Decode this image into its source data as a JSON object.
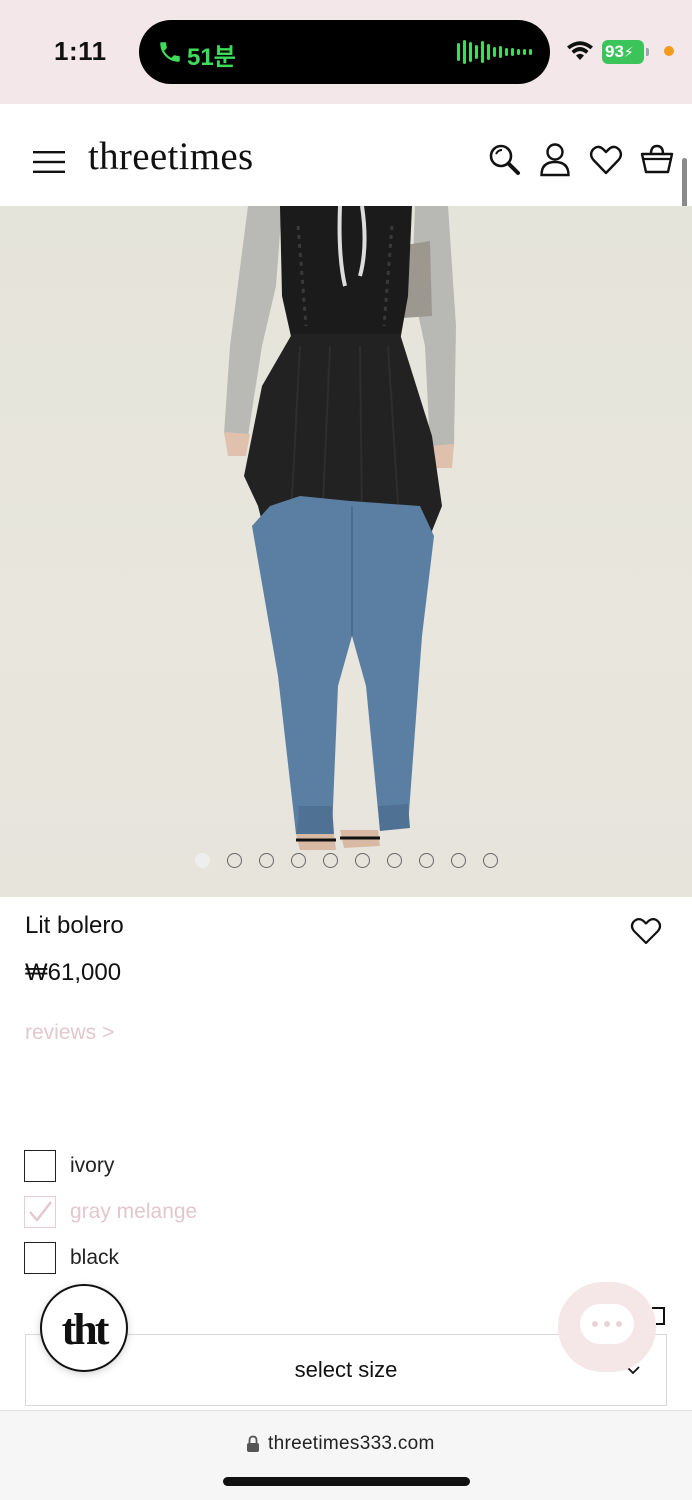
{
  "status_bar": {
    "time": "1:11",
    "call_duration": "51분",
    "battery": "93",
    "colors": {
      "call_green": "#3ddc5a",
      "battery_green": "#3bc45a",
      "mic_dot": "#f29a1a"
    }
  },
  "header": {
    "brand": "threetimes",
    "icons": [
      "menu-icon",
      "search-icon",
      "account-icon",
      "wishlist-icon",
      "cart-icon"
    ]
  },
  "gallery": {
    "image_count": 10,
    "active_index": 0,
    "description_icon": "model-photo"
  },
  "product": {
    "name": "Lit bolero",
    "price": "₩61,000",
    "reviews_link": "reviews >",
    "colors": [
      {
        "label": "ivory",
        "checked": false
      },
      {
        "label": "gray melange",
        "checked": true
      },
      {
        "label": "black",
        "checked": false
      }
    ],
    "size_select": {
      "label": "select size"
    }
  },
  "badge": {
    "text": "tht"
  },
  "browser": {
    "url": "threetimes333.com"
  },
  "theme": {
    "accent_pink": "#e2c7cd",
    "status_bg": "#f3e7e9"
  }
}
